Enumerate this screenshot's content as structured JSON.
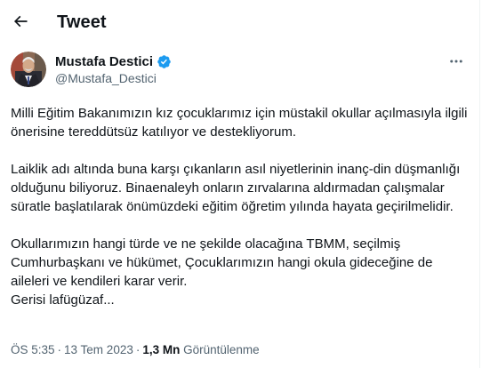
{
  "header": {
    "title": "Tweet"
  },
  "author": {
    "name": "Mustafa Destici",
    "handle": "@Mustafa_Destici",
    "verified": true,
    "verified_color": "#1d9bf0"
  },
  "tweet": {
    "paragraphs": [
      "Milli Eğitim Bakanımızın kız çocuklarımız için müstakil okullar açılmasıyla ilgili önerisine tereddütsüz katılıyor ve destekliyorum.",
      "Laiklik adı altında buna karşı çıkanların asıl niyetlerinin inanç-din düşmanlığı olduğunu biliyoruz. Binaenaleyh onların zırvalarına aldırmadan çalışmalar süratle başlatılarak önümüzdeki eğitim öğretim yılında hayata geçirilmelidir.",
      "Okullarımızın hangi türde ve ne şekilde olacağına TBMM, seçilmiş Cumhurbaşkanı ve hükümet, Çocuklarımızın hangi okula gideceğine de aileleri ve kendileri karar verir.\nGerisi lafügüzaf..."
    ]
  },
  "meta": {
    "time": "ÖS 5:35",
    "separator": "·",
    "date": "13 Tem 2023",
    "views_count": "1,3 Mn",
    "views_label": "Görüntülenme"
  },
  "colors": {
    "text_primary": "#0f1419",
    "text_secondary": "#536471",
    "accent": "#1d9bf0",
    "divider": "#eff3f4"
  },
  "icons": {
    "back": "arrow-left-icon",
    "more": "more-horizontal-icon",
    "verified": "verified-badge-icon"
  }
}
